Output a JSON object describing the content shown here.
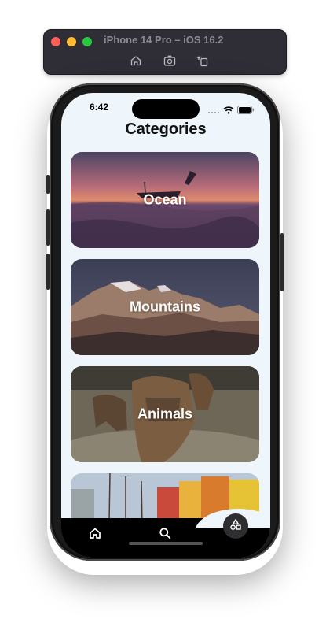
{
  "simulator": {
    "title": "iPhone 14 Pro – iOS 16.2",
    "tools": [
      {
        "name": "home-icon"
      },
      {
        "name": "screenshot-icon"
      },
      {
        "name": "rotate-icon"
      }
    ]
  },
  "status_bar": {
    "time": "6:42"
  },
  "page": {
    "title": "Categories"
  },
  "categories": [
    {
      "label": "Ocean"
    },
    {
      "label": "Mountains"
    },
    {
      "label": "Animals"
    },
    {
      "label": ""
    }
  ],
  "bottom_nav": {
    "items": [
      {
        "icon": "home-icon",
        "active": false
      },
      {
        "icon": "search-icon",
        "active": false
      },
      {
        "icon": "shapes-icon",
        "active": true
      }
    ]
  }
}
